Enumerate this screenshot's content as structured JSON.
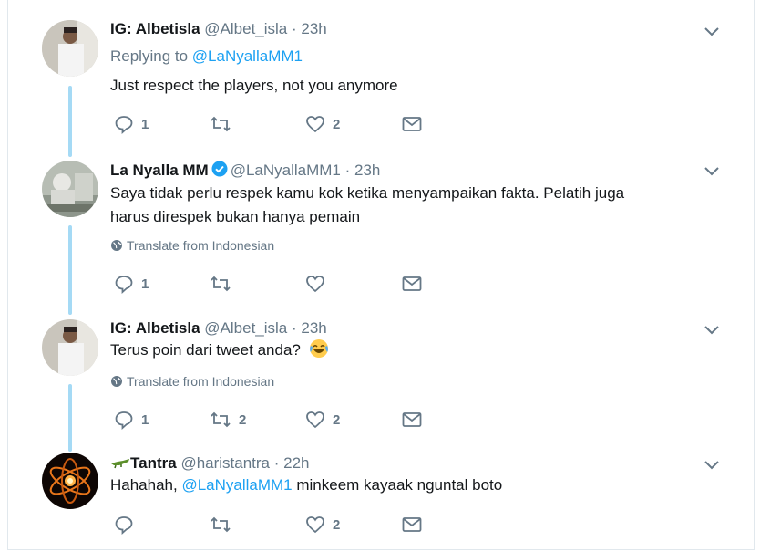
{
  "tweets": [
    {
      "name": "IG: Albetisla",
      "handle": "@Albet_isla",
      "time": "· 23h",
      "reply_prefix": "Replying to ",
      "reply_to": "@LaNyallaMM1",
      "text": "Just respect the players, not you anymore",
      "counts": {
        "reply": "1",
        "retweet": "",
        "like": "2"
      }
    },
    {
      "name": "La Nyalla MM",
      "handle": "@LaNyallaMM1",
      "time": "· 23h",
      "verified": true,
      "text_line1": "Saya tidak perlu respek kamu kok ketika menyampaikan fakta. Pelatih juga",
      "text_line2": "harus direspek bukan hanya pemain",
      "translate": "Translate from Indonesian",
      "counts": {
        "reply": "1",
        "retweet": "",
        "like": ""
      }
    },
    {
      "name": "IG: Albetisla",
      "handle": "@Albet_isla",
      "time": "· 23h",
      "text": "Terus poin dari tweet anda?",
      "emoji": "face-with-tears-of-joy",
      "translate": "Translate from Indonesian",
      "counts": {
        "reply": "1",
        "retweet": "2",
        "like": "2"
      }
    },
    {
      "name": "Tantra",
      "name_emoji": "crocodile",
      "handle": "@haristantra",
      "time": "· 22h",
      "text_before": "Hahahah, ",
      "mention": "@LaNyallaMM1",
      "text_after": " minkeem kayaak nguntal boto",
      "counts": {
        "reply": "",
        "retweet": "",
        "like": "2"
      }
    }
  ],
  "icons": [
    "reply-icon",
    "retweet-icon",
    "like-icon",
    "direct-message-icon",
    "chevron-down-icon",
    "verified-badge-icon",
    "globe-icon"
  ],
  "colors": {
    "link": "#1da1f2",
    "secondary": "#657786",
    "thread_line": "#a5daf5",
    "verified": "#1da1f2",
    "border": "#e1e8ed"
  }
}
